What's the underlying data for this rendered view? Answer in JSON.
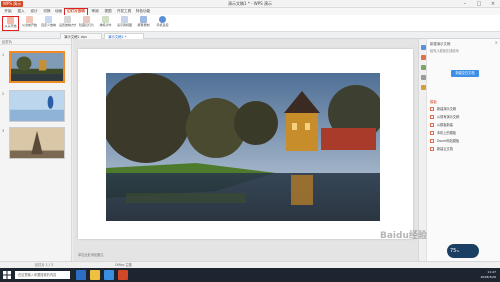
{
  "titlebar": {
    "app": "WPS 演示",
    "doc_title": "演示文稿1 * - WPS 演示"
  },
  "menu": {
    "tabs": [
      "开始",
      "插入",
      "设计",
      "切换",
      "动画",
      "幻灯片放映",
      "审阅",
      "视图",
      "开发工具",
      "特色功能"
    ],
    "active_index": 5
  },
  "ribbon": {
    "tools": [
      "从头开始",
      "从当前开始",
      "自定义放映",
      "设置放映方式",
      "隐藏幻灯片",
      "排练计时",
      "演示者视图",
      "屏幕录制",
      "手机遥控"
    ],
    "highlight_index": 0
  },
  "tabs": {
    "items": [
      "演示文稿1.dps",
      "演示文稿1 *"
    ],
    "active_index": 1
  },
  "thumbnails": {
    "header": "幻灯片",
    "numbers": [
      "1",
      "2",
      "3"
    ]
  },
  "notes": {
    "placeholder": "单击此处添加备注"
  },
  "taskpane": {
    "title": "新建演示文稿",
    "desc": "稻壳儿模板在线使用",
    "button": "新建空白文档",
    "section": "模板",
    "items": [
      "新建演示文稿",
      "从现有演示文稿",
      "从模板新建",
      "本机上的模板",
      "Docer网站模板",
      "新建云文档"
    ],
    "perf_value": "75",
    "perf_unit": "%"
  },
  "statusbar": {
    "left": "幻灯片 1 / 3",
    "middle": "Office 主题"
  },
  "taskbar": {
    "search_placeholder": "在这里输入你要搜索的内容",
    "time": "11:47",
    "date": "2018/3/26"
  },
  "watermark": "Baidu经验",
  "colors": {
    "accent": "#d24726",
    "highlight": "#e02020",
    "link": "#1f67c6"
  }
}
